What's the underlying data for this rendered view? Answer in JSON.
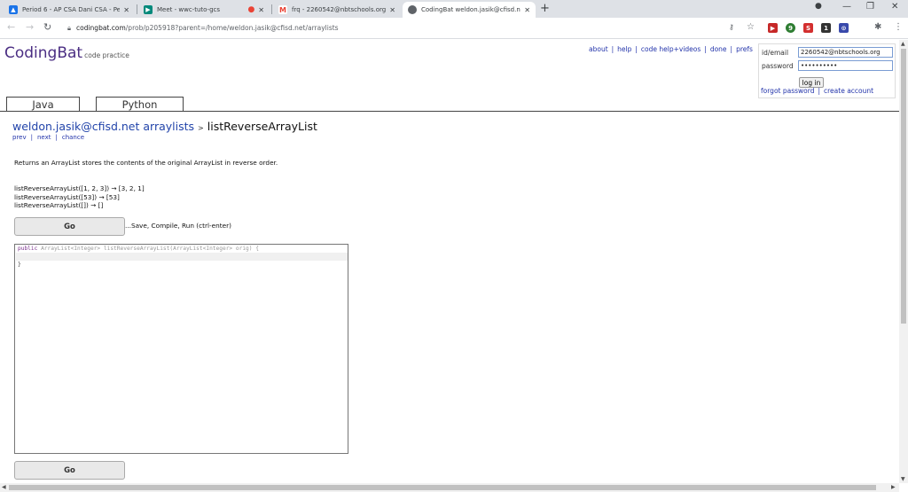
{
  "browser": {
    "tabs": [
      {
        "title": "Period 6 - AP CSA Dani CSA - Pe",
        "favicon_color": "#1a73e8"
      },
      {
        "title": "Meet - wwc-tuto-gcs",
        "favicon_color": "#00897b"
      },
      {
        "title": "frq - 2260542@nbtschools.org",
        "favicon_color": "#ea4335"
      },
      {
        "title": "CodingBat weldon.jasik@cfisd.ne",
        "favicon_color": "#5f6368"
      }
    ],
    "new_tab": "+",
    "address": {
      "domain": "codingbat.com",
      "path": "/prob/p205918?parent=/home/weldon.jasik@cfisd.net/arraylists"
    },
    "extensions": [
      {
        "label": "▶",
        "color": "#c62828"
      },
      {
        "label": "9",
        "color": "#2e7d32"
      },
      {
        "label": "S",
        "color": "#d32f2f"
      },
      {
        "label": "1",
        "color": "#333333"
      },
      {
        "label": "⊙",
        "color": "#3949ab"
      }
    ]
  },
  "site": {
    "logo": "CodingBat",
    "tagline": "code practice",
    "top_links": [
      "about",
      "help",
      "code help+videos",
      "done",
      "prefs"
    ],
    "login": {
      "id_label": "id/email",
      "id_value": "2260542@nbtschools.org",
      "password_label": "password",
      "password_value": "••••••••••",
      "login_button": "log in",
      "forgot": "forgot password",
      "create": "create account"
    },
    "lang_tabs": [
      "Java",
      "Python"
    ],
    "breadcrumb": {
      "user": "weldon.jasik@cfisd.net",
      "section": "arraylists",
      "sep": ">",
      "problem": "listReverseArrayList"
    },
    "subnav": [
      "prev",
      "next",
      "chance"
    ],
    "description": "Returns an ArrayList stores the contents of the original ArrayList in reverse order.",
    "examples": [
      "listReverseArrayList([1, 2, 3]) → [3, 2, 1]",
      "listReverseArrayList([53]) → [53]",
      "listReverseArrayList([]) → []"
    ],
    "go_label": "Go",
    "go_hint": "...Save, Compile, Run (ctrl-enter)",
    "code": {
      "keyword": "public",
      "signature": " ArrayList<Integer> listReverseArrayList(ArrayList<Integer> orig) {",
      "closing": "}"
    }
  }
}
